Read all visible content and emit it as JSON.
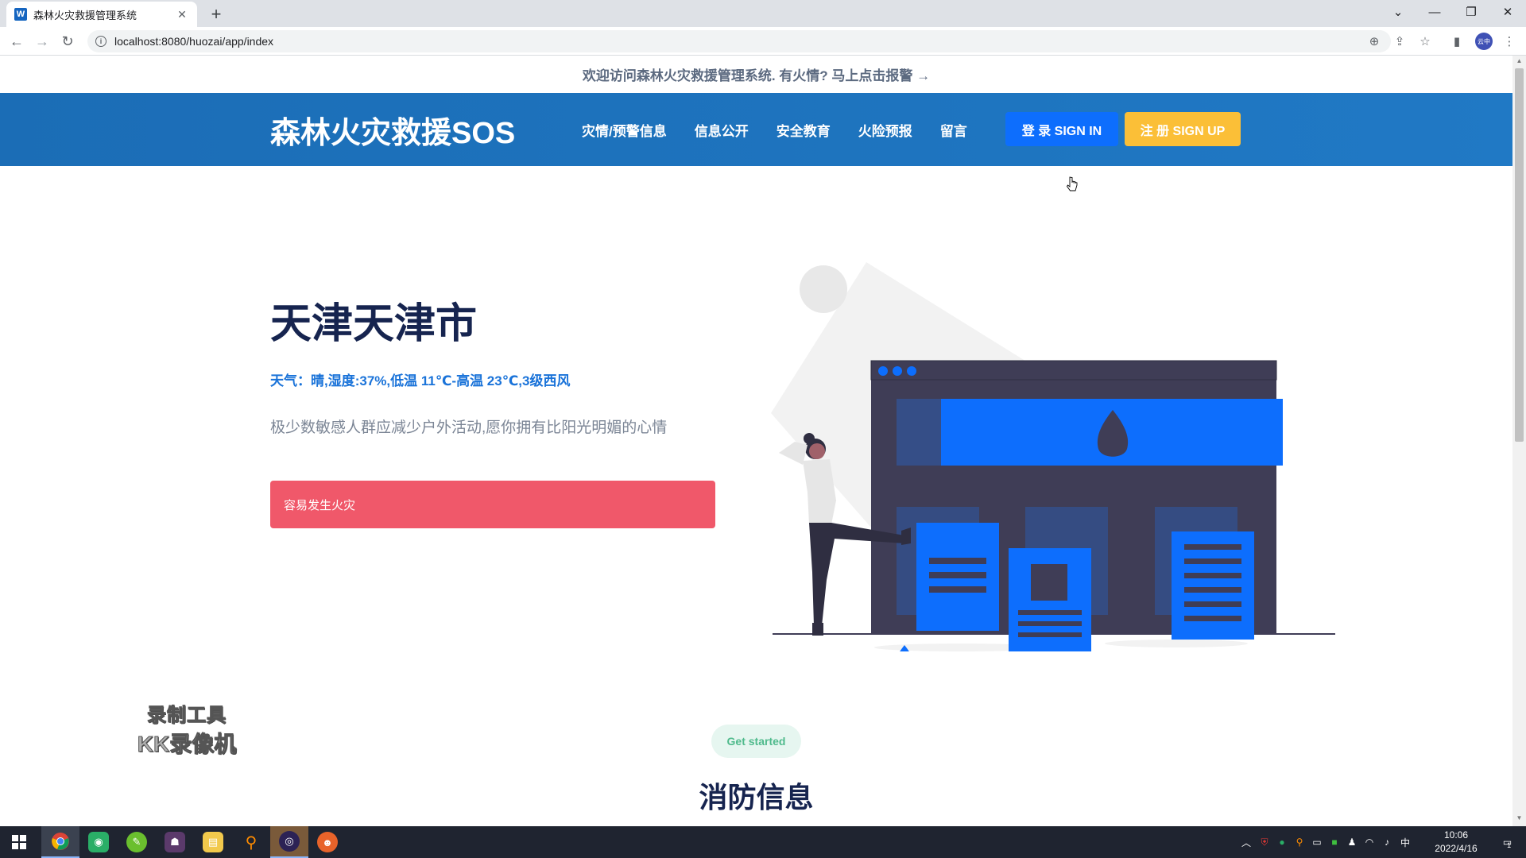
{
  "browser": {
    "tab_title": "森林火灾救援管理系统",
    "tab_favicon": "W",
    "url": "localhost:8080/huozai/app/index",
    "profile_label": "云中"
  },
  "page": {
    "notice": "欢迎访问森林火灾救援管理系统. 有火情? 马上点击报警 →",
    "header": {
      "brand": "森林火灾救援SOS",
      "nav": [
        "灾情/预警信息",
        "信息公开",
        "安全教育",
        "火险预报",
        "留言"
      ],
      "login_label": "登 录 SIGN IN",
      "signup_label": "注 册 SIGN UP"
    },
    "hero": {
      "city": "天津天津市",
      "weather": "天气：晴,湿度:37%,低温 11℃-高温 23℃,3级西风",
      "advice": "极少数敏感人群应减少户外活动,愿你拥有比阳光明媚的心情",
      "fire_risk": "容易发生火灾"
    },
    "watermark": {
      "line1": "录制工具",
      "line2": "KK录像机"
    },
    "section": {
      "pill": "Get started",
      "title": "消防信息"
    }
  },
  "taskbar": {
    "ime": "中",
    "time": "10:06",
    "date": "2022/4/16",
    "notification_count": "1"
  },
  "colors": {
    "header_blue": "#1f74c0",
    "login_button": "#0d6efd",
    "signup_button": "#fbbf37",
    "alert_red": "#f0586a",
    "heading_navy": "#16244f",
    "weather_blue": "#1a73d9",
    "pill_green": "#4fba8c"
  }
}
